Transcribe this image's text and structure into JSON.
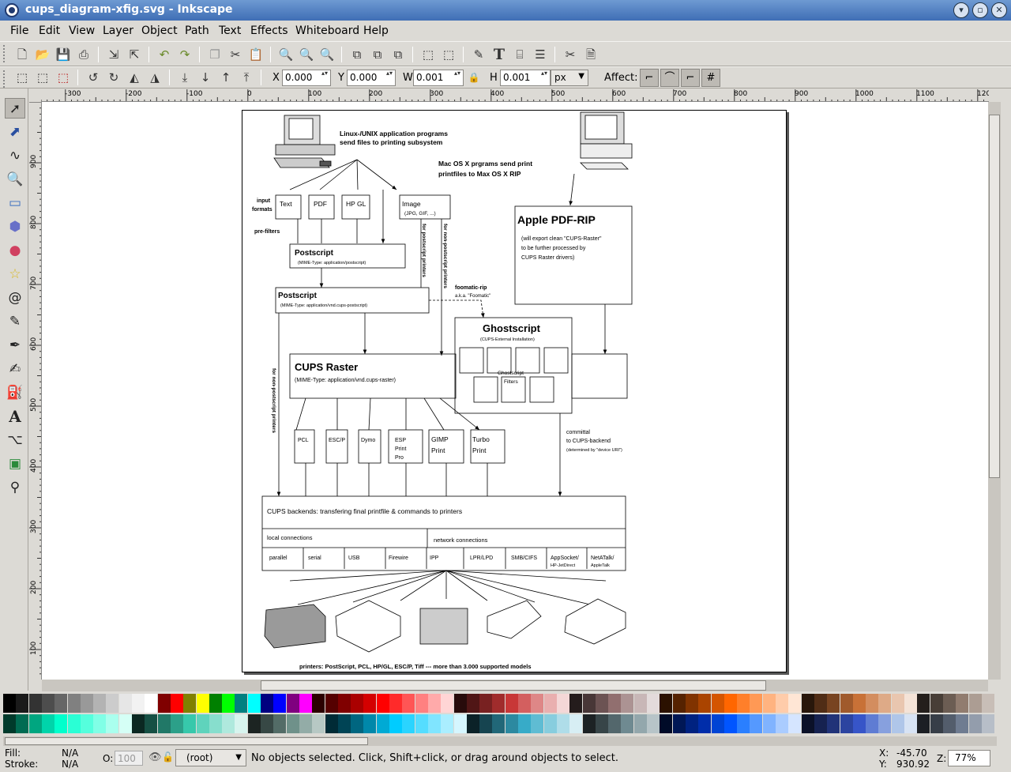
{
  "window": {
    "title": "cups_diagram-xfig.svg - Inkscape"
  },
  "menu": [
    "File",
    "Edit",
    "View",
    "Layer",
    "Object",
    "Path",
    "Text",
    "Effects",
    "Whiteboard",
    "Help"
  ],
  "toolbar": {
    "icons": [
      "new-icon",
      "open-icon",
      "save-icon",
      "print-icon",
      "import-icon",
      "export-icon",
      "undo-icon",
      "redo-icon",
      "duplicate-icon",
      "cut-icon",
      "paste-icon",
      "zoom-selection-icon",
      "zoom-drawing-icon",
      "zoom-page-icon",
      "group-icon",
      "ungroup-icon",
      "clone-icon",
      "node-editor-icon",
      "transform-icon",
      "fill-stroke-icon",
      "text-tool-icon",
      "xml-editor-icon",
      "align-icon",
      "preferences-icon",
      "document-properties-icon"
    ]
  },
  "controls": {
    "x_label": "X",
    "x_value": "0.000",
    "y_label": "Y",
    "y_value": "0.000",
    "w_label": "W",
    "w_value": "0.001",
    "h_label": "H",
    "h_value": "0.001",
    "unit": "px",
    "affect_label": "Affect:"
  },
  "tools": [
    "selector-icon",
    "node-icon",
    "tweak-icon",
    "zoom-icon",
    "rectangle-icon",
    "3d-box-icon",
    "ellipse-icon",
    "star-icon",
    "spiral-icon",
    "pencil-icon",
    "pen-icon",
    "calligraphy-icon",
    "bucket-icon",
    "text-icon",
    "connector-icon",
    "gradient-icon",
    "dropper-icon"
  ],
  "ruler": {
    "h_labels": [
      "-300",
      "-200",
      "-100",
      "0",
      "100",
      "200",
      "300",
      "400",
      "500",
      "600",
      "700",
      "800",
      "900",
      "1000",
      "1100",
      "1200"
    ],
    "v_labels": [
      "100",
      "200",
      "300",
      "400",
      "500",
      "600",
      "700",
      "800",
      "900"
    ]
  },
  "diagram": {
    "unix_programs": "Linux-/UNIX application programs",
    "unix_programs2": "send files to printing subsystem",
    "mac_programs": "Mac OS X prgrams send print",
    "mac_programs2": "printfiles to Max OS X RIP",
    "input": "input",
    "formats": "formats",
    "prefilters": "pre-filters",
    "text": "Text",
    "pdf": "PDF",
    "hpgl": "HP GL",
    "image": "Image",
    "image_sub": "(JPG, GIF, ...)",
    "postscript1": "Postscript",
    "postscript1_sub": "(MIME-Type: application/postscript)",
    "postscript2": "Postscript",
    "postscript2_sub": "(MIME-Type: application/vnd.cups-postscript)",
    "for_ps": "for postscript printers",
    "for_nonps": "for non-postscript printers",
    "for_nonps2": "for non-postscript printers",
    "foomatic": "foomatic-rip",
    "foomatic_sub": "a.k.a. \"Foomatic\"",
    "ghostscript": "Ghostscript",
    "ghostscript_sub": "(CUPS-External Installation)",
    "gs_filters1": "Ghostscript",
    "gs_filters2": "Filters",
    "apple_rip": "Apple PDF-RIP",
    "apple_l1": "(will export clean \"CUPS-Raster\"",
    "apple_l2": "to be further processed by",
    "apple_l3": "CUPS Raster drivers)",
    "raster": "CUPS Raster",
    "raster_sub": "(MIME-Type: application/vnd.cups-raster)",
    "pcl": "PCL",
    "escp": "ESC/P",
    "dymo": "Dymo",
    "esp1": "ESP",
    "esp2": "Print",
    "esp3": "Pro",
    "gimp1": "GIMP",
    "gimp2": "Print",
    "turbo1": "Turbo",
    "turbo2": "Print",
    "committal1": "committal",
    "committal2": "to CUPS-backend",
    "committal3": "(determined by \"device URI\")",
    "backends": "CUPS backends: transfering final printfile & commands to printers",
    "local": "local connections",
    "network": "network connections",
    "conns": [
      "parallel",
      "serial",
      "USB",
      "Firewire",
      "IPP",
      "LPR/LPD",
      "SMB/CIFS",
      "AppSocket/",
      "NetATalk/"
    ],
    "conn_sub1": "HP-JetDirect",
    "conn_sub2": "AppleTalk",
    "printers": "printers: PostScript, PCL, HP/GL, ESC/P, Tiff  ---  more than 3.000 supported models"
  },
  "status": {
    "fill_label": "Fill:",
    "fill_value": "N/A",
    "stroke_label": "Stroke:",
    "stroke_value": "N/A",
    "opacity_label": "O:",
    "opacity_value": "100",
    "layer": "(root)",
    "message": "No objects selected. Click, Shift+click, or drag around objects to select.",
    "x_label": "X:",
    "x_value": "-45.70",
    "y_label": "Y:",
    "y_value": "930.92",
    "zoom_label": "Z:",
    "zoom_value": "77%"
  },
  "palette": {
    "row1": [
      "#000000",
      "#1a1a1a",
      "#333333",
      "#4d4d4d",
      "#666666",
      "#808080",
      "#999999",
      "#b3b3b3",
      "#cccccc",
      "#e6e6e6",
      "#f2f2f2",
      "#ffffff",
      "#800000",
      "#ff0000",
      "#808000",
      "#ffff00",
      "#008000",
      "#00ff00",
      "#008080",
      "#00ffff",
      "#000080",
      "#0000ff",
      "#800080",
      "#ff00ff",
      "#2b0000",
      "#550000",
      "#800000",
      "#aa0000",
      "#d40000",
      "#ff0000",
      "#ff2a2a",
      "#ff5555",
      "#ff8080",
      "#ffaaaa",
      "#ffd5d5",
      "#280b0b",
      "#501616",
      "#782121",
      "#a02c2c",
      "#c83737",
      "#d35f5f",
      "#de8787",
      "#e9afaf",
      "#f4d7d7",
      "#241c1c",
      "#483737",
      "#6c5353",
      "#916f6f",
      "#ac9393",
      "#c8b7b7",
      "#e3dbdb",
      "#2b1100",
      "#552200",
      "#803300",
      "#aa4400",
      "#d45500",
      "#ff6600",
      "#ff7f2a",
      "#ff9955",
      "#ffb380",
      "#ffccaa",
      "#ffe6d5",
      "#28170b",
      "#502d16",
      "#784421",
      "#a05a2c",
      "#c87137",
      "#d38d5f",
      "#deaa87",
      "#e9c6af",
      "#f4e3d7",
      "#241f1c",
      "#483e37",
      "#6c5d53",
      "#917c6f",
      "#ac9d93",
      "#c8beb7"
    ],
    "row2": [
      "#003a2b",
      "#006b52",
      "#00a680",
      "#00d4aa",
      "#00ffcc",
      "#2affd5",
      "#55ffdd",
      "#80ffe6",
      "#aaffee",
      "#d5fff6",
      "#0b2822",
      "#165044",
      "#217867",
      "#2ca089",
      "#37c8ab",
      "#5fd3bc",
      "#87decd",
      "#afe9dd",
      "#d7f4ee",
      "#1c2422",
      "#374845",
      "#536c67",
      "#6f918a",
      "#93aca7",
      "#b7c8c4",
      "#002b36",
      "#004455",
      "#006680",
      "#0088aa",
      "#00aad4",
      "#00ccff",
      "#2ad4ff",
      "#55ddff",
      "#80e5ff",
      "#aaeeff",
      "#d5f6ff",
      "#0b2228",
      "#164450",
      "#216778",
      "#2c89a0",
      "#37abc8",
      "#5fbcd3",
      "#87cdde",
      "#afdde9",
      "#d7eef4",
      "#1c2224",
      "#374548",
      "#53676c",
      "#6f8a91",
      "#93a7ac",
      "#b7c4c8",
      "#000b28",
      "#001755",
      "#002280",
      "#002daa",
      "#0044d4",
      "#0055ff",
      "#2a7fff",
      "#5599ff",
      "#80b3ff",
      "#aaccff",
      "#d5e5ff",
      "#0b1128",
      "#162250",
      "#213378",
      "#2c44a0",
      "#3755c8",
      "#5f7cd3",
      "#87a0de",
      "#afc6e9",
      "#d7e3f4",
      "#1c1f24",
      "#373e48",
      "#535d6c",
      "#6f7c91",
      "#939dac",
      "#b7bec8"
    ]
  }
}
